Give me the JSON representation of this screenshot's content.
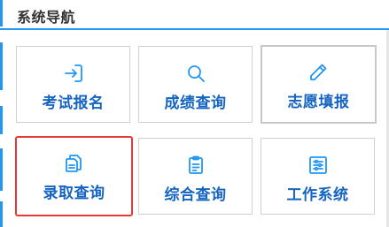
{
  "header": {
    "title": "系统导航"
  },
  "colors": {
    "accent": "#2196f3",
    "label": "#1565c0",
    "active_border": "#e53935"
  },
  "tiles": [
    {
      "label": "考试报名",
      "icon": "login-arrow-icon"
    },
    {
      "label": "成绩查询",
      "icon": "search-icon"
    },
    {
      "label": "志愿填报",
      "icon": "pencil-icon"
    },
    {
      "label": "录取查询",
      "icon": "documents-icon"
    },
    {
      "label": "综合查询",
      "icon": "clipboard-icon"
    },
    {
      "label": "工作系统",
      "icon": "sliders-icon"
    }
  ]
}
